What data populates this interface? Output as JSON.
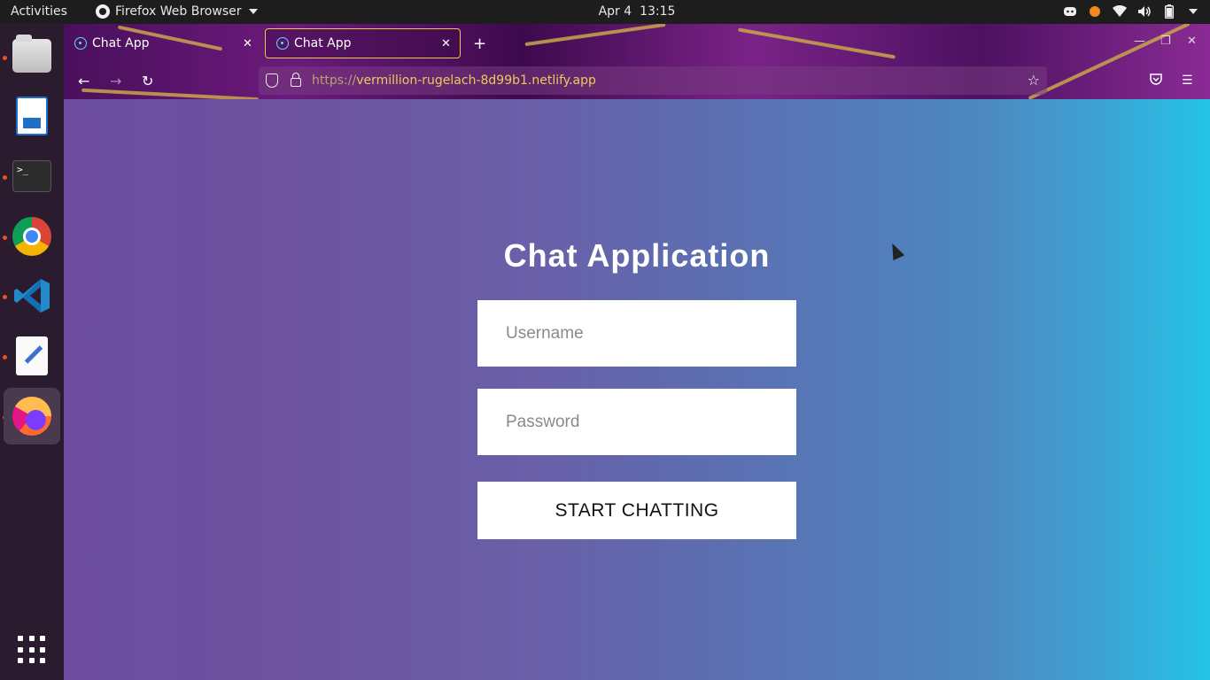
{
  "topbar": {
    "activities": "Activities",
    "app_name": "Firefox Web Browser",
    "date": "Apr 4",
    "time": "13:15"
  },
  "dock": {
    "items": [
      "files",
      "libreoffice-writer",
      "terminal",
      "chrome",
      "vscode",
      "text-editor",
      "firefox"
    ],
    "terminal_prompt": ">_"
  },
  "browser": {
    "tabs": [
      {
        "title": "Chat App",
        "selected": false
      },
      {
        "title": "Chat App",
        "selected": true
      }
    ],
    "url_scheme": "https://",
    "url_host": "vermillion-rugelach-8d99b1.netlify.app"
  },
  "page": {
    "title": "Chat Application",
    "username_placeholder": "Username",
    "password_placeholder": "Password",
    "submit_label": "START CHATTING"
  },
  "colors": {
    "accent_tab_border": "#f0c74a",
    "url_text": "#f1c95a",
    "bg_left": "#6d4ea0",
    "bg_right": "#23c4e4"
  }
}
